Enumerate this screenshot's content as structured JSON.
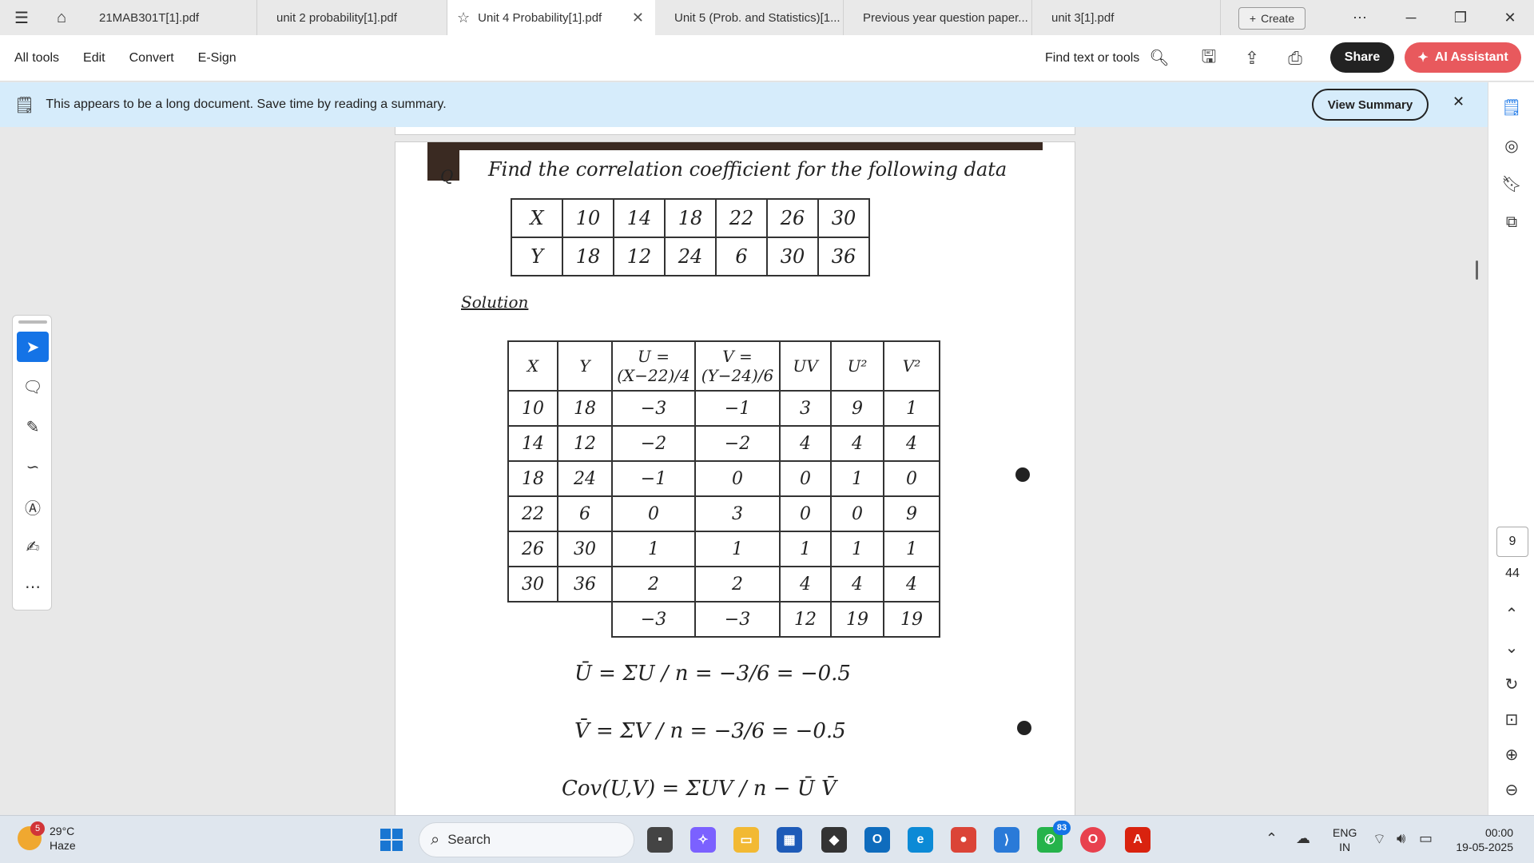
{
  "tabs": [
    {
      "label": "21MAB301T[1].pdf"
    },
    {
      "label": "unit 2 probability[1].pdf"
    },
    {
      "label": "Unit 4 Probability[1].pdf"
    },
    {
      "label": "Unit 5 (Prob. and Statistics)[1..."
    },
    {
      "label": "Previous year question paper..."
    },
    {
      "label": "unit 3[1].pdf"
    }
  ],
  "create_label": "Create",
  "menu": [
    "All tools",
    "Edit",
    "Convert",
    "E-Sign"
  ],
  "find_label": "Find text or tools",
  "share_label": "Share",
  "ai_label": "AI Assistant",
  "banner": {
    "text": "This appears to be a long document. Save time by reading a summary.",
    "button": "View Summary"
  },
  "page": {
    "current": "9",
    "total": "44"
  },
  "document": {
    "question": "Find the correlation coefficient for the following data",
    "q_mark": "Q",
    "table1": [
      [
        "X",
        "10",
        "14",
        "18",
        "22",
        "26",
        "30"
      ],
      [
        "Y",
        "18",
        "12",
        "24",
        "6",
        "30",
        "36"
      ]
    ],
    "solution_label": "Solution",
    "table2_header": [
      "X",
      "Y",
      "U = (X−22)/4",
      "V = (Y−24)/6",
      "UV",
      "U²",
      "V²"
    ],
    "table2_rows": [
      [
        "10",
        "18",
        "−3",
        "−1",
        "3",
        "9",
        "1"
      ],
      [
        "14",
        "12",
        "−2",
        "−2",
        "4",
        "4",
        "4"
      ],
      [
        "18",
        "24",
        "−1",
        "0",
        "0",
        "1",
        "0"
      ],
      [
        "22",
        "6",
        "0",
        "3",
        "0",
        "0",
        "9"
      ],
      [
        "26",
        "30",
        "1",
        "1",
        "1",
        "1",
        "1"
      ],
      [
        "30",
        "36",
        "2",
        "2",
        "4",
        "4",
        "4"
      ]
    ],
    "table2_totals": [
      "",
      "",
      "−3",
      "−3",
      "12",
      "19",
      "19"
    ],
    "formula_u": "Ū = ΣU / n = −3/6 = −0.5",
    "formula_v": "V̄ = ΣV / n = −3/6 = −0.5",
    "formula_cov": "Cov(U,V) = ΣUV / n − Ū V̄"
  },
  "weather": {
    "temp": "29°C",
    "desc": "Haze",
    "badge": "5"
  },
  "search_placeholder": "Search",
  "whatsapp_badge": "83",
  "lang": {
    "line1": "ENG",
    "line2": "IN"
  },
  "clock": {
    "time": "00:00",
    "date": "19-05-2025"
  }
}
